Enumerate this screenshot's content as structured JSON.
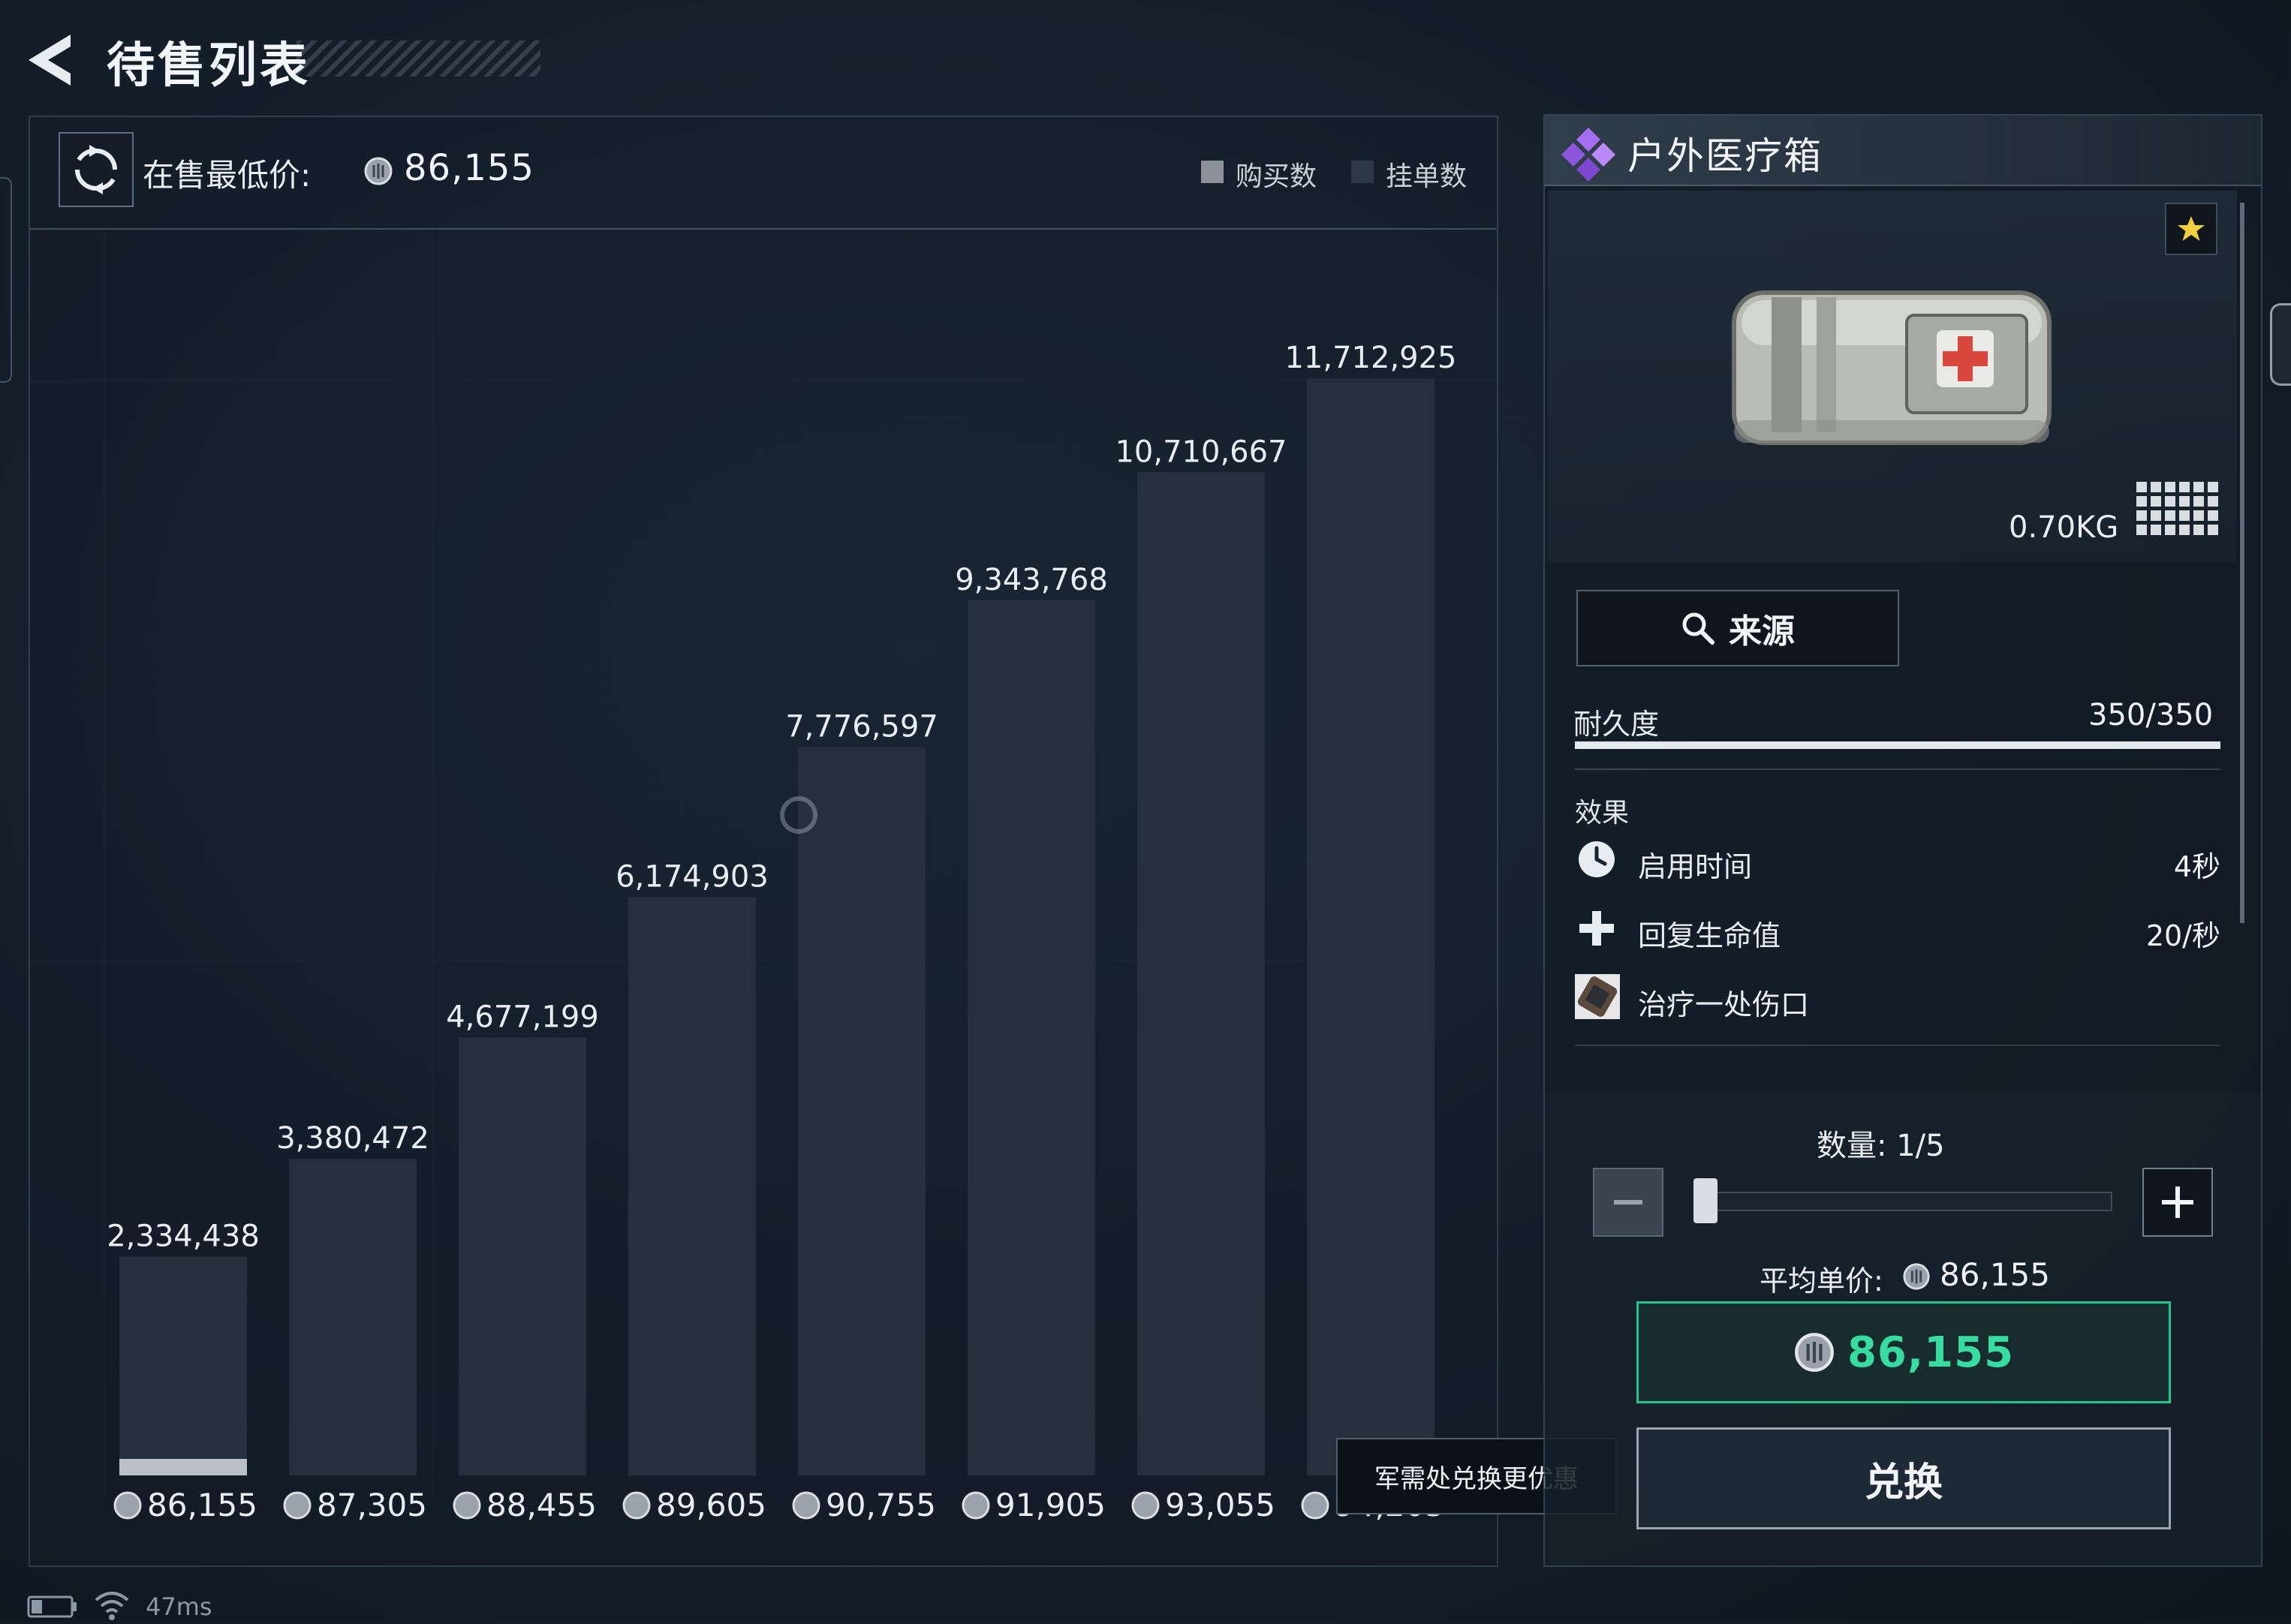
{
  "header": {
    "title": "待售列表"
  },
  "chart_header": {
    "lowest_price_label": "在售最低价:",
    "lowest_price_value": "86,155",
    "legend_buy": "购买数",
    "legend_listing": "挂单数"
  },
  "chart_data": {
    "type": "bar",
    "categories": [
      "86,155",
      "87,305",
      "88,455",
      "89,605",
      "90,755",
      "91,905",
      "93,055",
      "94,205"
    ],
    "values": [
      2334438,
      3380472,
      4677199,
      6174903,
      7776597,
      9343768,
      10710667,
      11712925
    ],
    "value_labels": [
      "2,334,438",
      "3,380,472",
      "4,677,199",
      "6,174,903",
      "7,776,597",
      "9,343,768",
      "10,710,667",
      "11,712,925"
    ],
    "buy_counts": [
      1,
      0,
      0,
      0,
      0,
      0,
      0,
      0
    ],
    "ylim": [
      0,
      12500000
    ],
    "legend": [
      "购买数",
      "挂单数"
    ],
    "colors": {
      "listing": "#25303c",
      "buy": "#b9c0c6"
    }
  },
  "tooltip": {
    "text": "军需处兑换更优惠"
  },
  "item": {
    "name": "户外医疗箱",
    "weight": "0.70KG",
    "source_label": "来源",
    "durability_label": "耐久度",
    "durability_value": "350/350",
    "durability_fraction": 1.0,
    "effects_label": "效果",
    "effects": [
      {
        "icon": "clock-icon",
        "label": "启用时间",
        "value": "4秒"
      },
      {
        "icon": "plus-health-icon",
        "label": "回复生命值",
        "value": "20/秒"
      },
      {
        "icon": "bandage-icon",
        "label": "治疗一处伤口",
        "value": ""
      }
    ],
    "rarity_color": "#a56ef0"
  },
  "purchase": {
    "quantity_label": "数量: 1/5",
    "quantity": 1,
    "quantity_max": 5,
    "avg_price_label": "平均单价:",
    "avg_price_value": "86,155",
    "total_value": "86,155",
    "exchange_label": "兑换",
    "accent": "#36dca0"
  },
  "status": {
    "ping": "47ms"
  }
}
